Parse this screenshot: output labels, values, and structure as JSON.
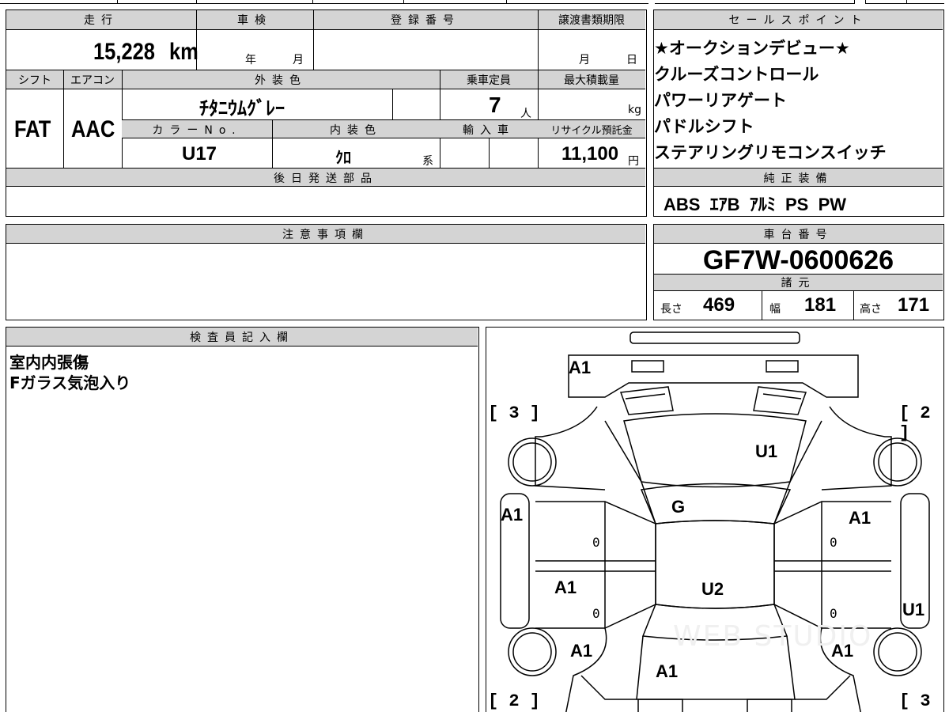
{
  "top_partial": {
    "text": "車検"
  },
  "mileage": {
    "label": "走行",
    "value": "15,228",
    "unit": "km"
  },
  "inspection": {
    "label": "車検",
    "year_unit": "年",
    "month_unit": "月"
  },
  "registration": {
    "label": "登録番号"
  },
  "transfer": {
    "label": "譲渡書類期限",
    "month_unit": "月",
    "day_unit": "日"
  },
  "shift": {
    "label": "シフト",
    "value": "FAT"
  },
  "aircon": {
    "label": "エアコン",
    "value": "AAC"
  },
  "exterior": {
    "label": "外装色",
    "value": "ﾁﾀﾆｳﾑｸﾞﾚｰ"
  },
  "capacity": {
    "label": "乗車定員",
    "value": "7",
    "unit": "人"
  },
  "max_load": {
    "label": "最大積載量",
    "unit": "kg"
  },
  "color_no": {
    "label": "カラーNo.",
    "value": "U17"
  },
  "interior": {
    "label": "内装色",
    "value": "ｸﾛ",
    "unit": "系"
  },
  "import": {
    "label": "輸入車"
  },
  "recycle": {
    "label": "リサイクル預託金",
    "value": "11,100",
    "unit": "円"
  },
  "later_parts": {
    "label": "後日発送部品"
  },
  "notes": {
    "label": "注意事項欄"
  },
  "sales_points": {
    "label": "セールスポイント",
    "items": [
      "★オークションデビュー★",
      "クルーズコントロール",
      "パワーリアゲート",
      "パドルシフト",
      "ステアリングリモコンスイッチ"
    ]
  },
  "equipment": {
    "label": "純正装備",
    "value": "ABS  ｴｱB  ｱﾙﾐ  PS  PW"
  },
  "chassis": {
    "label": "車台番号",
    "value": "GF7W-0600626"
  },
  "specs": {
    "label": "諸元",
    "length_label": "長さ",
    "length": "469",
    "width_label": "幅",
    "width": "181",
    "height_label": "高さ",
    "height": "171"
  },
  "inspector": {
    "label": "検査員記入欄",
    "lines": [
      "室内内張傷",
      "Fガラス気泡入り"
    ]
  },
  "diagram": {
    "marks": {
      "front": "A1",
      "bonnet": "U1",
      "windshield": "G",
      "roof": "U2",
      "left_front_door": "A1",
      "right_front_door": "A1",
      "left_rear_door": "A1",
      "right_rear_door": "U1",
      "left_rear_fender": "A1",
      "right_rear_fender": "A1",
      "rear": "A1"
    },
    "brackets": {
      "top_left": "[ 3 ]",
      "top_right": "[ 2 ]",
      "bottom_left": "[ 2 ]",
      "bottom_right": "[ 3 ]"
    },
    "zeros": [
      "0",
      "0",
      "0",
      "0"
    ],
    "watermark": "WEB STUDIO"
  }
}
